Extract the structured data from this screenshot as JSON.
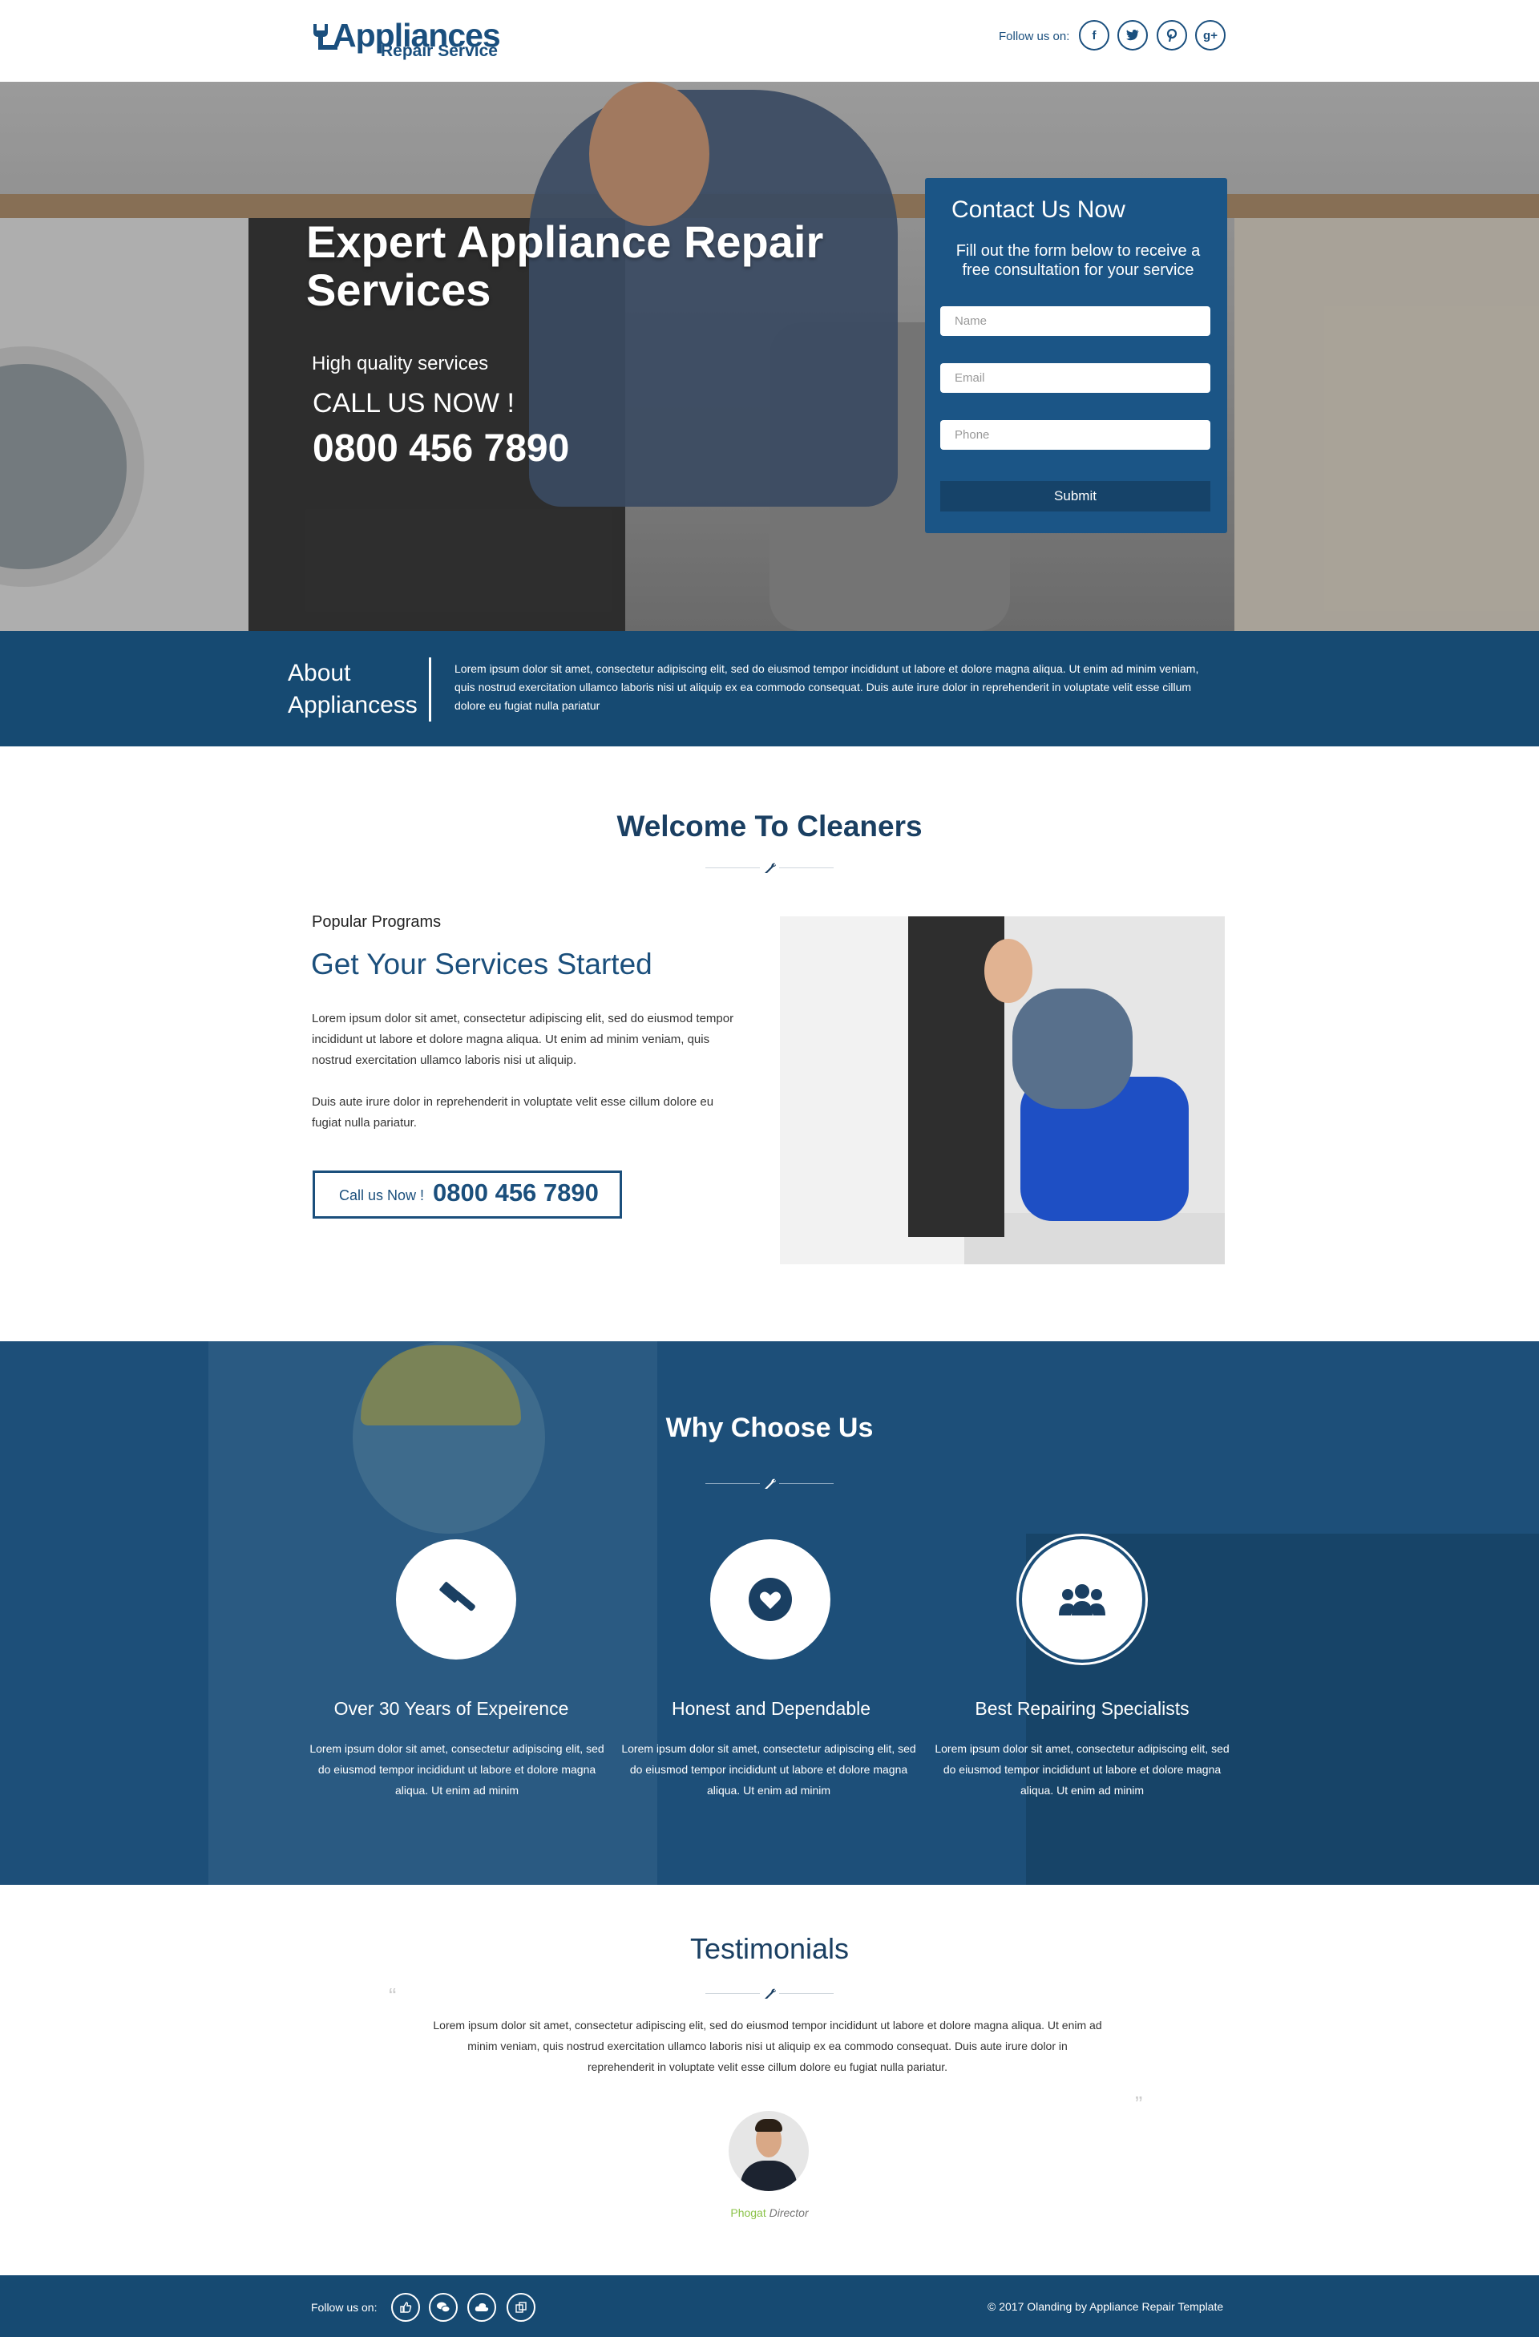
{
  "header": {
    "logo_line1": "Appliances",
    "logo_line2": "Repair Service",
    "follow_label": "Follow us on:",
    "social": [
      {
        "icon": "facebook-icon",
        "glyph": "f"
      },
      {
        "icon": "twitter-icon",
        "glyph": "t"
      },
      {
        "icon": "pinterest-icon",
        "glyph": "p"
      },
      {
        "icon": "google-plus-icon",
        "glyph": "g+"
      }
    ]
  },
  "hero": {
    "title": "Expert Appliance Repair Services",
    "subtitle": "High quality services",
    "call_label": "CALL US NOW !",
    "phone": "0800 456 7890"
  },
  "contact_form": {
    "title": "Contact Us Now",
    "description": "Fill out the form below to receive a free consultation for your service",
    "name_placeholder": "Name",
    "email_placeholder": "Email",
    "phone_placeholder": "Phone",
    "submit_label": "Submit"
  },
  "about": {
    "title": "About Appliancess",
    "text": "Lorem ipsum dolor sit amet, consectetur adipiscing elit, sed do eiusmod tempor incididunt ut labore et dolore magna aliqua. Ut enim ad minim veniam, quis nostrud exercitation ullamco laboris nisi ut aliquip ex ea commodo consequat. Duis aute irure dolor in reprehenderit in voluptate velit esse cillum dolore eu fugiat nulla pariatur"
  },
  "welcome": {
    "title": "Welcome To Cleaners",
    "small_heading": "Popular Programs",
    "heading": "Get Your Services Started",
    "paragraph1": "Lorem ipsum dolor sit amet, consectetur adipiscing elit, sed do eiusmod tempor incididunt ut labore et dolore magna aliqua. Ut enim ad minim veniam, quis nostrud exercitation ullamco laboris nisi ut aliquip.",
    "paragraph2": "Duis aute irure dolor in reprehenderit in voluptate velit esse cillum dolore eu fugiat nulla pariatur.",
    "call_label": "Call us Now !",
    "call_phone": "0800 456 7890"
  },
  "why": {
    "title": "Why Choose Us",
    "items": [
      {
        "icon": "gavel-icon",
        "heading": "Over 30 Years of Expeirence",
        "text": "Lorem ipsum dolor sit amet, consectetur adipiscing elit, sed do eiusmod tempor incididunt ut labore et dolore magna aliqua. Ut enim ad minim"
      },
      {
        "icon": "heart-icon",
        "heading": "Honest and Dependable",
        "text": "Lorem ipsum dolor sit amet, consectetur adipiscing elit, sed do eiusmod tempor incididunt ut labore et dolore magna aliqua. Ut enim ad minim"
      },
      {
        "icon": "users-icon",
        "heading": "Best Repairing  Specialists",
        "text": "Lorem ipsum dolor sit amet, consectetur adipiscing elit, sed do eiusmod tempor incididunt ut labore et dolore magna aliqua. Ut enim ad minim"
      }
    ]
  },
  "testimonials": {
    "title": "Testimonials",
    "quote_open": "“",
    "quote_close": "”",
    "text": "Lorem ipsum dolor sit amet, consectetur adipiscing elit, sed do eiusmod tempor incididunt ut labore et dolore magna aliqua. Ut enim ad minim veniam, quis nostrud exercitation ullamco laboris nisi ut aliquip ex ea commodo consequat. Duis aute irure dolor in reprehenderit in voluptate velit esse cillum dolore eu fugiat nulla pariatur.",
    "name": "Phogat",
    "role": "Director"
  },
  "footer": {
    "follow_label": "Follow us on:",
    "social": [
      {
        "icon": "thumbs-up-icon"
      },
      {
        "icon": "chat-icon"
      },
      {
        "icon": "cloud-icon"
      },
      {
        "icon": "copy-icon"
      }
    ],
    "copyright": "© 2017 Olanding by Appliance Repair Template"
  },
  "colors": {
    "primary": "#1b5586",
    "dark": "#164a72",
    "heading": "#1a3f62",
    "accent_green": "#8bc34a"
  }
}
